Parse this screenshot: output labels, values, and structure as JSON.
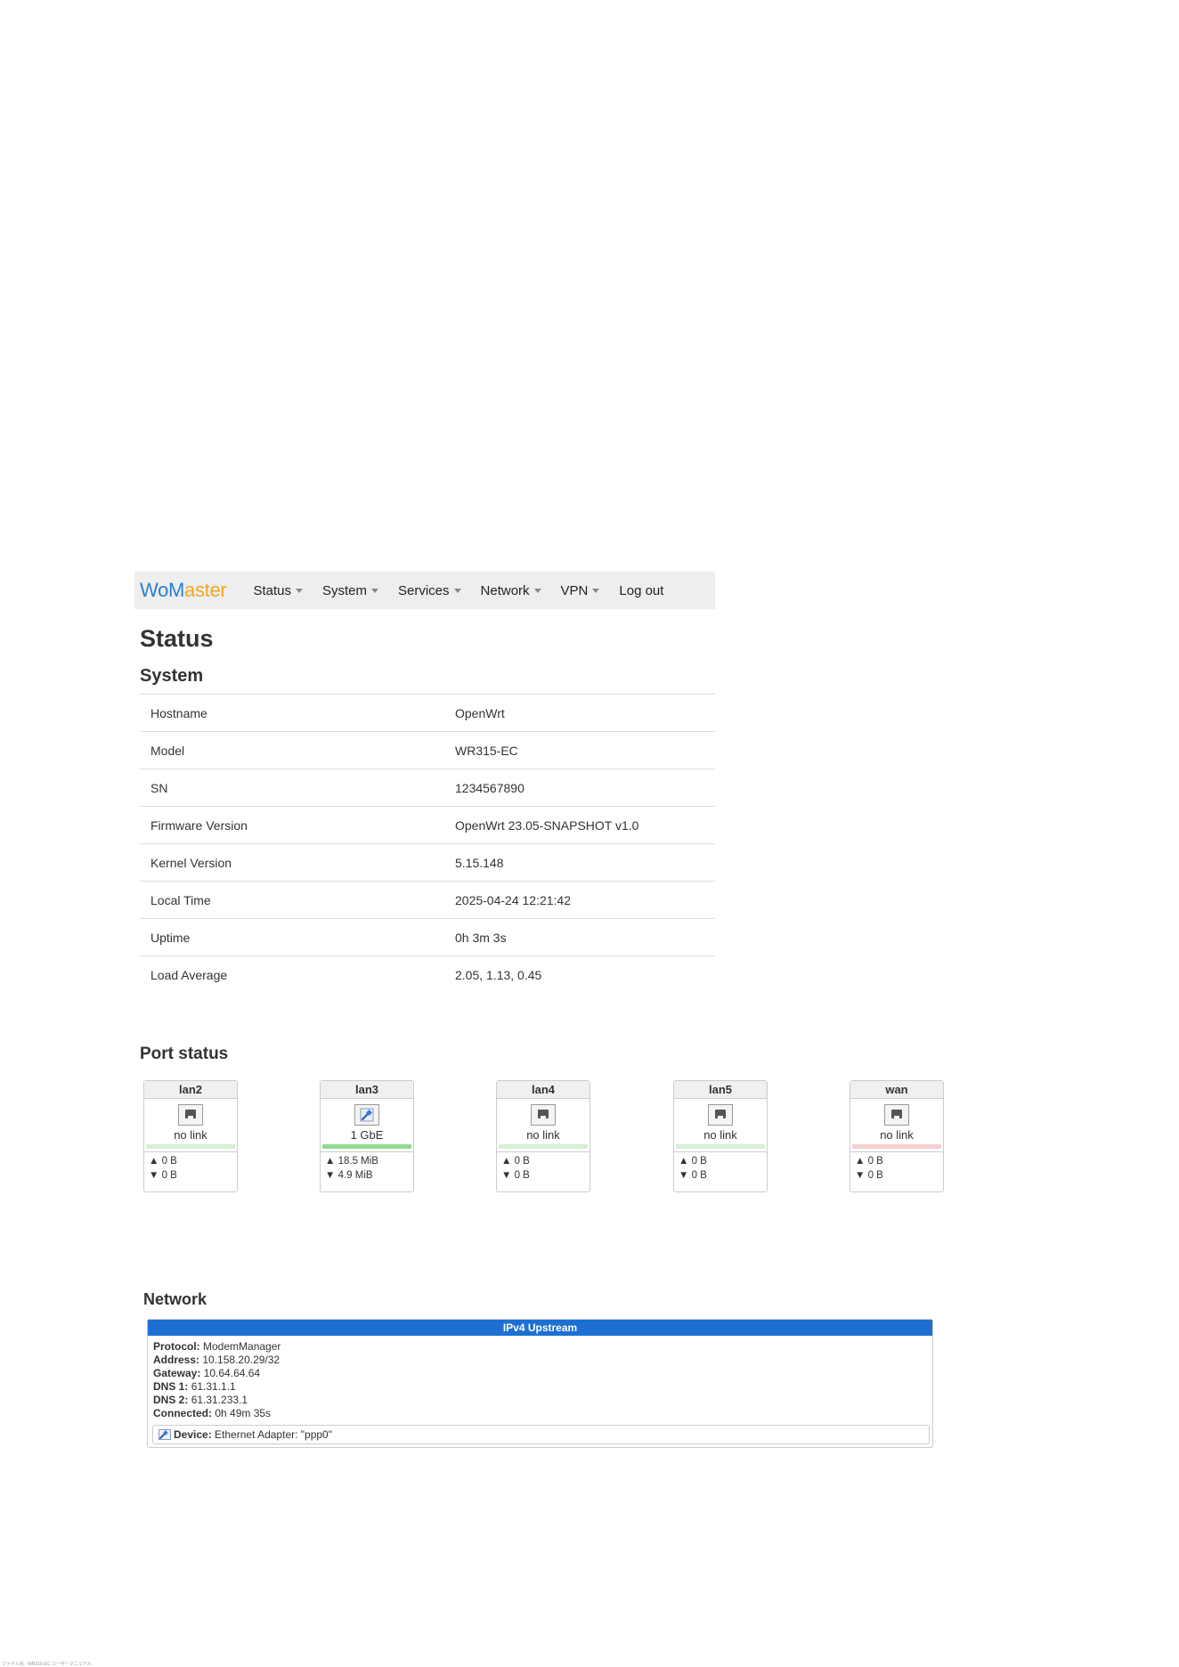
{
  "brand": {
    "part1": "WoM",
    "part2": "aster"
  },
  "colors": {
    "brand_blue": "#2b7fd0",
    "brand_orange": "#f5a623",
    "upstream_header": "#1e6fd2",
    "link_ok": "#8fdc8f",
    "link_off_lan": "#d6efd6",
    "link_off_wan": "#f4d0d0"
  },
  "nav": {
    "items": [
      {
        "label": "Status",
        "dropdown": true
      },
      {
        "label": "System",
        "dropdown": true
      },
      {
        "label": "Services",
        "dropdown": true
      },
      {
        "label": "Network",
        "dropdown": true
      },
      {
        "label": "VPN",
        "dropdown": true
      },
      {
        "label": "Log out",
        "dropdown": false
      }
    ]
  },
  "page": {
    "title": "Status"
  },
  "system": {
    "heading": "System",
    "rows": [
      {
        "key": "Hostname",
        "value": "OpenWrt"
      },
      {
        "key": "Model",
        "value": "WR315-EC"
      },
      {
        "key": "SN",
        "value": "1234567890"
      },
      {
        "key": "Firmware Version",
        "value": "OpenWrt 23.05-SNAPSHOT v1.0"
      },
      {
        "key": "Kernel Version",
        "value": "5.15.148"
      },
      {
        "key": "Local Time",
        "value": "2025-04-24 12:21:42"
      },
      {
        "key": "Uptime",
        "value": "0h 3m 3s"
      },
      {
        "key": "Load Average",
        "value": "2.05, 1.13, 0.45"
      }
    ]
  },
  "ports": {
    "heading": "Port status",
    "items": [
      {
        "name": "lan2",
        "speed": "no link",
        "connected": false,
        "tx": "▲ 0 B",
        "rx": "▼ 0 B",
        "bar": "lan"
      },
      {
        "name": "lan3",
        "speed": "1 GbE",
        "connected": true,
        "tx": "▲ 18.5 MiB",
        "rx": "▼ 4.9 MiB",
        "bar": "ok"
      },
      {
        "name": "lan4",
        "speed": "no link",
        "connected": false,
        "tx": "▲ 0 B",
        "rx": "▼ 0 B",
        "bar": "lan"
      },
      {
        "name": "lan5",
        "speed": "no link",
        "connected": false,
        "tx": "▲ 0 B",
        "rx": "▼ 0 B",
        "bar": "lan"
      },
      {
        "name": "wan",
        "speed": "no link",
        "connected": false,
        "tx": "▲ 0 B",
        "rx": "▼ 0 B",
        "bar": "wan"
      }
    ]
  },
  "network": {
    "heading": "Network",
    "panel_title": "IPv4 Upstream",
    "fields": [
      {
        "label": "Protocol:",
        "value": "ModemManager"
      },
      {
        "label": "Address:",
        "value": "10.158.20.29/32"
      },
      {
        "label": "Gateway:",
        "value": "10.64.64.64"
      },
      {
        "label": "DNS 1:",
        "value": "61.31.1.1"
      },
      {
        "label": "DNS 2:",
        "value": "61.31.233.1"
      },
      {
        "label": "Connected:",
        "value": "0h 49m 35s"
      }
    ],
    "device": {
      "label": "Device:",
      "value": "Ethernet Adapter: \"ppp0\""
    }
  },
  "footer": {
    "text": "ファイル名 : WR315-EC ユーザーマニュアル"
  }
}
